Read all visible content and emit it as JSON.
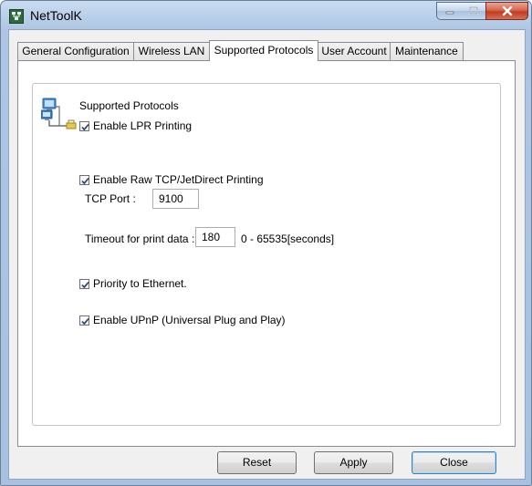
{
  "window": {
    "title": "NetToolK",
    "app_icon": "network-app-icon"
  },
  "caption_buttons": [
    "minimize-icon",
    "maximize-icon",
    "close-icon"
  ],
  "tabs": [
    {
      "label": "General Configuration",
      "active": false
    },
    {
      "label": "Wireless LAN",
      "active": false
    },
    {
      "label": "Supported Protocols",
      "active": true
    },
    {
      "label": "User Account",
      "active": false
    },
    {
      "label": "Maintenance",
      "active": false
    }
  ],
  "group": {
    "title": "Supported Protocols",
    "icon": "network-computers-icon"
  },
  "options": {
    "lpr": {
      "label": "Enable LPR Printing",
      "checked": true
    },
    "raw": {
      "label": "Enable Raw TCP/JetDirect Printing",
      "checked": true
    },
    "tcp_port": {
      "label": "TCP Port :",
      "value": "9100"
    },
    "timeout": {
      "label": "Timeout for print data :",
      "value": "180",
      "range": "0 - 65535[seconds]"
    },
    "ethernet": {
      "label": "Priority to Ethernet.",
      "checked": true
    },
    "upnp": {
      "label": "Enable UPnP (Universal Plug and Play)",
      "checked": true
    }
  },
  "buttons": {
    "reset": "Reset",
    "apply": "Apply",
    "close": "Close"
  },
  "colors": {
    "accent": "#3c7fb1",
    "window_frame": "#a8c1e0",
    "close_button": "#c13c24"
  }
}
